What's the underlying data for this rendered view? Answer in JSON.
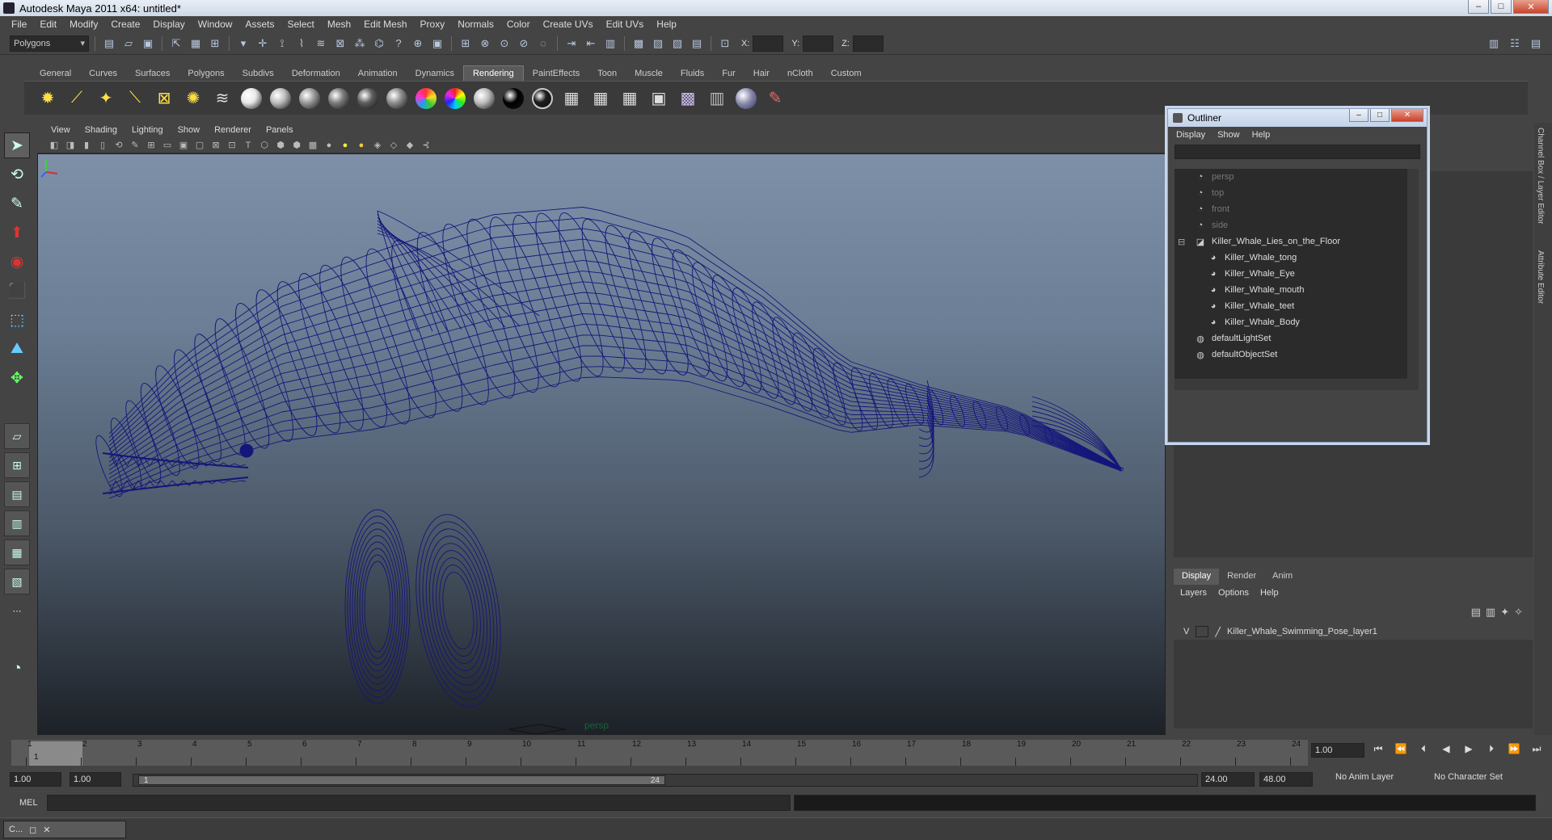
{
  "window": {
    "title": "Autodesk Maya 2011 x64: untitled*",
    "minimize": "–",
    "maximize": "□",
    "close": "✕"
  },
  "menu": [
    "File",
    "Edit",
    "Modify",
    "Create",
    "Display",
    "Window",
    "Assets",
    "Select",
    "Mesh",
    "Edit Mesh",
    "Proxy",
    "Normals",
    "Color",
    "Create UVs",
    "Edit UVs",
    "Help"
  ],
  "status_line": {
    "mode": "Polygons",
    "coord_x_label": "X:",
    "coord_y_label": "Y:",
    "coord_z_label": "Z:"
  },
  "shelf": {
    "tabs": [
      "General",
      "Curves",
      "Surfaces",
      "Polygons",
      "Subdivs",
      "Deformation",
      "Animation",
      "Dynamics",
      "Rendering",
      "PaintEffects",
      "Toon",
      "Muscle",
      "Fluids",
      "Fur",
      "Hair",
      "nCloth",
      "Custom"
    ],
    "active_tab": "Rendering",
    "sphere_colors": [
      "#e8e8e8",
      "#bdbdbd",
      "#9a9a9a",
      "#7c7c7c",
      "#5e5e5e",
      "#8e8e8e",
      "#bdbdbd",
      "#000000",
      "#1c1c1c"
    ]
  },
  "panel": {
    "menus": [
      "View",
      "Shading",
      "Lighting",
      "Show",
      "Renderer",
      "Panels"
    ],
    "camera_label": "persp",
    "wireframe_color": "#15157a"
  },
  "outliner": {
    "title": "Outliner",
    "menus": [
      "Display",
      "Show",
      "Help"
    ],
    "items": [
      {
        "label": "persp",
        "icon": "camera-icon",
        "dim": true,
        "indent": 0
      },
      {
        "label": "top",
        "icon": "camera-icon",
        "dim": true,
        "indent": 0
      },
      {
        "label": "front",
        "icon": "camera-icon",
        "dim": true,
        "indent": 0
      },
      {
        "label": "side",
        "icon": "camera-icon",
        "dim": true,
        "indent": 0
      },
      {
        "label": "Killer_Whale_Lies_on_the_Floor",
        "icon": "group-icon",
        "dim": false,
        "indent": 0,
        "expand": "⊟"
      },
      {
        "label": "Killer_Whale_tong",
        "icon": "mesh-icon",
        "dim": false,
        "indent": 1
      },
      {
        "label": "Killer_Whale_Eye",
        "icon": "mesh-icon",
        "dim": false,
        "indent": 1
      },
      {
        "label": "Killer_Whale_mouth",
        "icon": "mesh-icon",
        "dim": false,
        "indent": 1
      },
      {
        "label": "Killer_Whale_teet",
        "icon": "mesh-icon",
        "dim": false,
        "indent": 1
      },
      {
        "label": "Killer_Whale_Body",
        "icon": "mesh-icon",
        "dim": false,
        "indent": 1
      },
      {
        "label": "defaultLightSet",
        "icon": "set-icon",
        "dim": false,
        "indent": 0
      },
      {
        "label": "defaultObjectSet",
        "icon": "set-icon",
        "dim": false,
        "indent": 0
      }
    ]
  },
  "right_panel": {
    "side_tabs": [
      "Channel Box / Layer Editor",
      "Attribute Editor"
    ],
    "layer_tabs": [
      "Display",
      "Render",
      "Anim"
    ],
    "active_layer_tab": "Display",
    "layer_menus": [
      "Layers",
      "Options",
      "Help"
    ],
    "layers": [
      {
        "visible": "V",
        "name": "Killer_Whale_Swimming_Pose_layer1"
      }
    ]
  },
  "time_slider": {
    "ticks": [
      "1",
      "2",
      "3",
      "4",
      "5",
      "6",
      "7",
      "8",
      "9",
      "10",
      "11",
      "12",
      "13",
      "14",
      "15",
      "16",
      "17",
      "18",
      "19",
      "20",
      "21",
      "22",
      "23",
      "24"
    ],
    "current_marker": "1",
    "current_frame": "1.00"
  },
  "range_slider": {
    "start_time": "1.00",
    "playback_start": "1.00",
    "handle_start": "1",
    "handle_end": "24",
    "playback_end": "24.00",
    "end_time": "48.00",
    "anim_layer": "No Anim Layer",
    "character_set": "No Character Set"
  },
  "command_line": {
    "label": "MEL"
  },
  "taskbar": {
    "item": "C..."
  }
}
